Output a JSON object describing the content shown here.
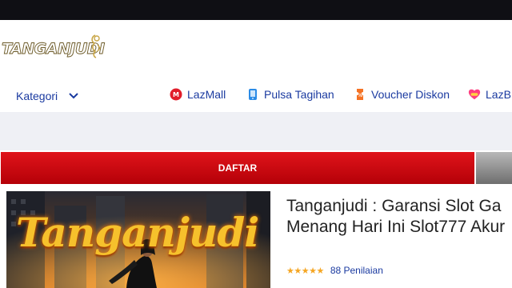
{
  "header": {
    "logo_text": "TANGANJUDI"
  },
  "nav": {
    "kategori_label": "Kategori",
    "links": [
      {
        "label": "LazMall",
        "icon": "lazmall-icon",
        "color": "#e11d2a"
      },
      {
        "label": "Pulsa Tagihan",
        "icon": "phone-bill-icon",
        "color": "#2b8be6"
      },
      {
        "label": "Voucher Diskon",
        "icon": "voucher-icon",
        "color": "#f57224"
      },
      {
        "label": "LazB",
        "icon": "lazblog-icon",
        "color": "#ff3d7f"
      }
    ]
  },
  "cta": {
    "daftar_label": "DAFTAR",
    "primary_color": "#c8000a"
  },
  "hero": {
    "banner_text": "Tanganjudi"
  },
  "product": {
    "title_line1": "Tanganjudi : Garansi Slot Ga",
    "title_line2": "Menang Hari Ini Slot777 Akur",
    "stars": "★★★★★",
    "rating_count": "88 Penilaian"
  }
}
